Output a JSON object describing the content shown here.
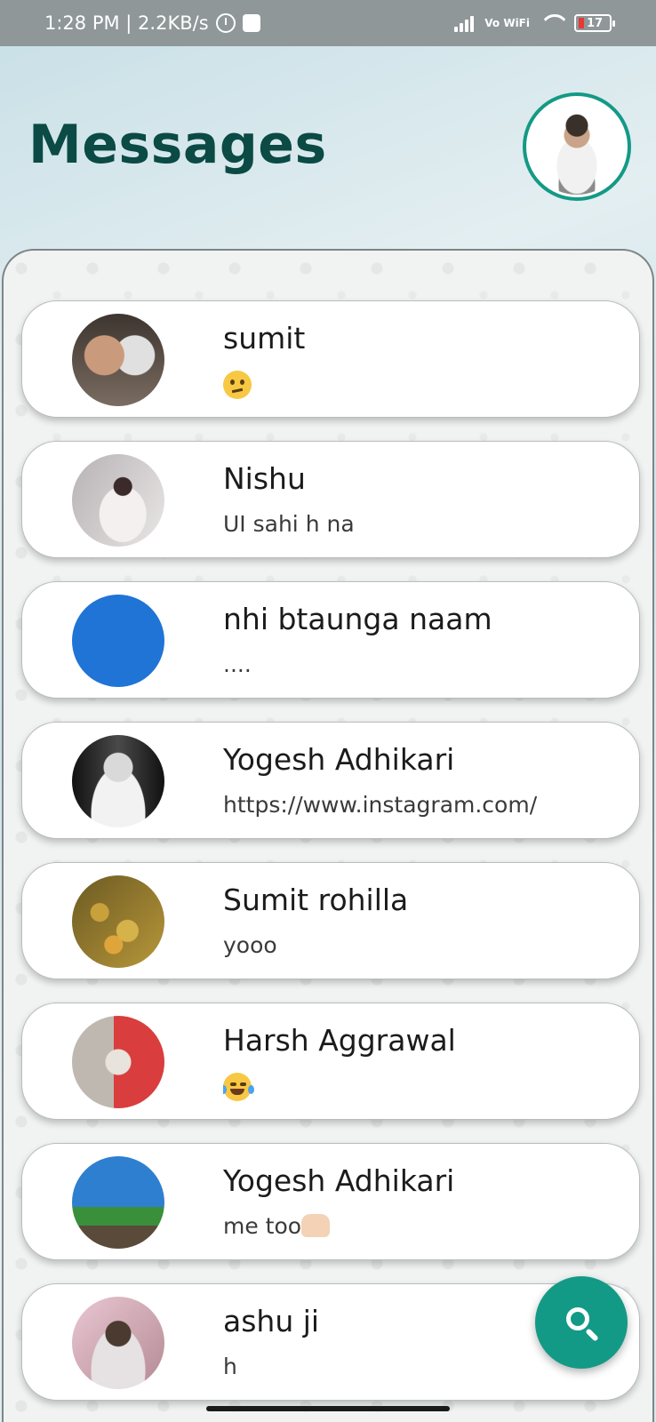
{
  "status_bar": {
    "time_speed": "1:28 PM | 2.2KB/s",
    "network": "Vo WiFi",
    "battery": "17"
  },
  "header": {
    "title": "Messages",
    "profile_icon": "user-avatar-icon"
  },
  "chats": [
    {
      "name": "sumit",
      "message": "",
      "message_emoji": "confused-face-emoji",
      "avatar_color": "#6d6259"
    },
    {
      "name": "Nishu",
      "message": "UI sahi h na",
      "avatar_color": "#c9c1c4"
    },
    {
      "name": "nhi btaunga naam",
      "message": "....",
      "avatar_color": "#1f74d6"
    },
    {
      "name": "Yogesh Adhikari",
      "message": "https://www.instagram.com/",
      "avatar_color": "#3b3b3b"
    },
    {
      "name": "Sumit rohilla",
      "message": "yooo",
      "avatar_color": "#a88a2e"
    },
    {
      "name": "Harsh Aggrawal",
      "message": "",
      "message_emoji": "face-with-tears-of-joy-emoji",
      "avatar_color": "#d93d3d"
    },
    {
      "name": "Yogesh Adhikari",
      "message": "me too",
      "message_emoji": "raising-hands-emoji",
      "avatar_color": "#3c7fc0"
    },
    {
      "name": "ashu ji",
      "message": "h",
      "avatar_color": "#b08a8f"
    }
  ],
  "fab": {
    "icon": "search-icon"
  },
  "colors": {
    "accent": "#139a86",
    "title": "#0b4a45"
  }
}
